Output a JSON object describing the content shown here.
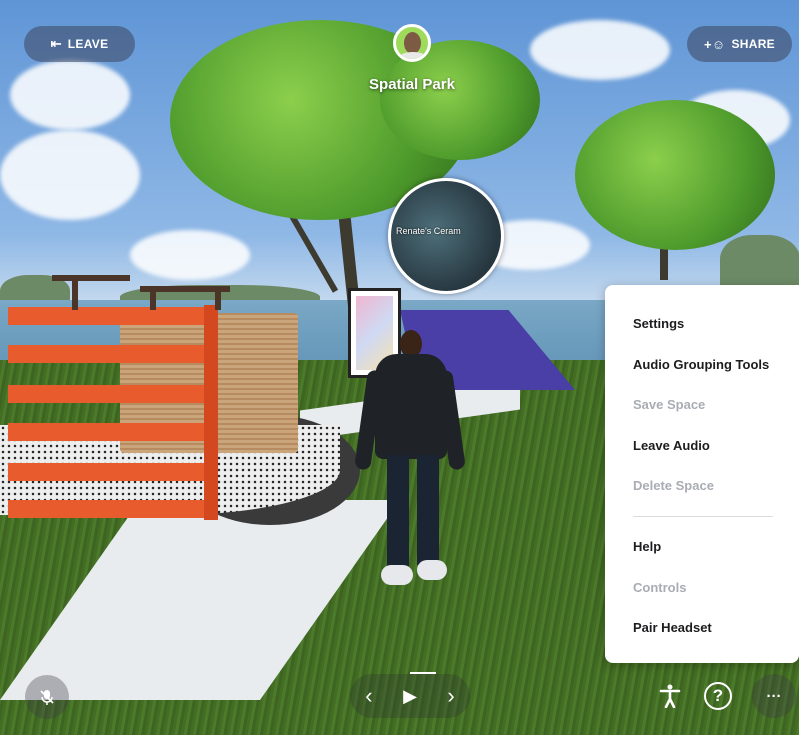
{
  "header": {
    "leave_icon": "leave-arrow-icon",
    "leave_label": "LEAVE",
    "share_icon": "add-person-icon",
    "share_label": "SHARE",
    "space_title": "Spatial Park"
  },
  "scene": {
    "orb_label": "Renate's Ceram"
  },
  "menu": {
    "items": [
      {
        "label": "Settings",
        "enabled": true
      },
      {
        "label": "Audio Grouping Tools",
        "enabled": true
      },
      {
        "label": "Save Space",
        "enabled": false
      },
      {
        "label": "Leave Audio",
        "enabled": true
      },
      {
        "label": "Delete Space",
        "enabled": false
      },
      {
        "label": "Help",
        "enabled": true
      },
      {
        "label": "Controls",
        "enabled": false
      },
      {
        "label": "Pair Headset",
        "enabled": true
      }
    ]
  },
  "bottom_bar": {
    "mic_icon": "mic-muted-icon",
    "prev_icon": "‹",
    "play_icon": "▶",
    "next_icon": "›",
    "accessibility_icon": "accessibility-icon",
    "help_icon": "?",
    "more_icon": "···"
  },
  "colors": {
    "menu_bg": "#ffffff",
    "menu_text": "#1d1d1f",
    "menu_disabled": "#a9adb3",
    "pill_bg": "#3c465f"
  }
}
